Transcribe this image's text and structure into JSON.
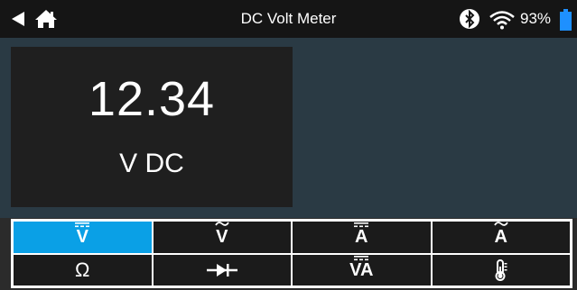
{
  "status_bar": {
    "title": "DC Volt Meter",
    "battery_percent": "93%",
    "icons": [
      "back-arrow-icon",
      "home-icon",
      "bluetooth-icon",
      "wifi-icon",
      "battery-icon"
    ]
  },
  "reading": {
    "value": "12.34",
    "unit": "V DC"
  },
  "modes": [
    {
      "label": "V",
      "type": "dc",
      "active": true
    },
    {
      "label": "V",
      "type": "ac",
      "active": false
    },
    {
      "label": "A",
      "type": "dc",
      "active": false
    },
    {
      "label": "A",
      "type": "ac",
      "active": false
    },
    {
      "label": "Ω",
      "type": "resistance",
      "active": false
    },
    {
      "label": "",
      "type": "diode",
      "icon": "diode-icon",
      "active": false
    },
    {
      "label": "VA",
      "type": "dc",
      "active": false
    },
    {
      "label": "",
      "type": "temperature",
      "icon": "thermometer-icon",
      "active": false
    }
  ],
  "colors": {
    "accent": "#0aa0e6",
    "status_bar_bg": "#151515",
    "main_bg": "#2a3a44",
    "reading_bg": "#1f1f1f",
    "battery": "#1e90ff"
  }
}
